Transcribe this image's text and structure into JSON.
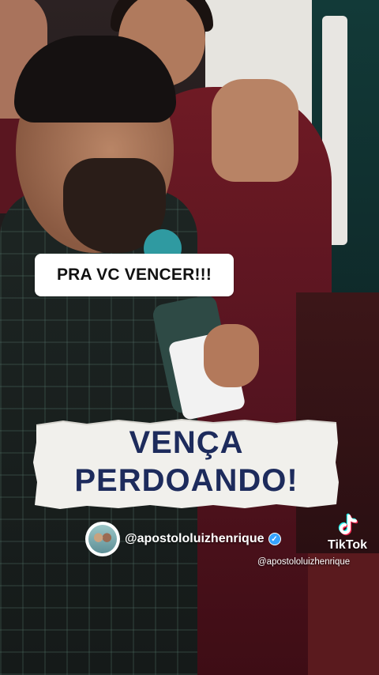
{
  "video": {
    "caption_top": "PRA VC VENCER!!!",
    "banner_line1": "VENÇA",
    "banner_line2": "PERDOANDO!",
    "profile_handle": "@apostololuizhenrique"
  },
  "watermark": {
    "brand": "TikTok",
    "handle": "@apostololuizhenrique"
  },
  "colors": {
    "banner_text": "#1d2b5c",
    "banner_paper": "#f1f0ec",
    "verified": "#36a3ff",
    "tiktok_cyan": "#25f4ee",
    "tiktok_red": "#fe2c55"
  },
  "icons": {
    "verified": "verified-badge-icon",
    "tiktok": "tiktok-logo-icon"
  }
}
